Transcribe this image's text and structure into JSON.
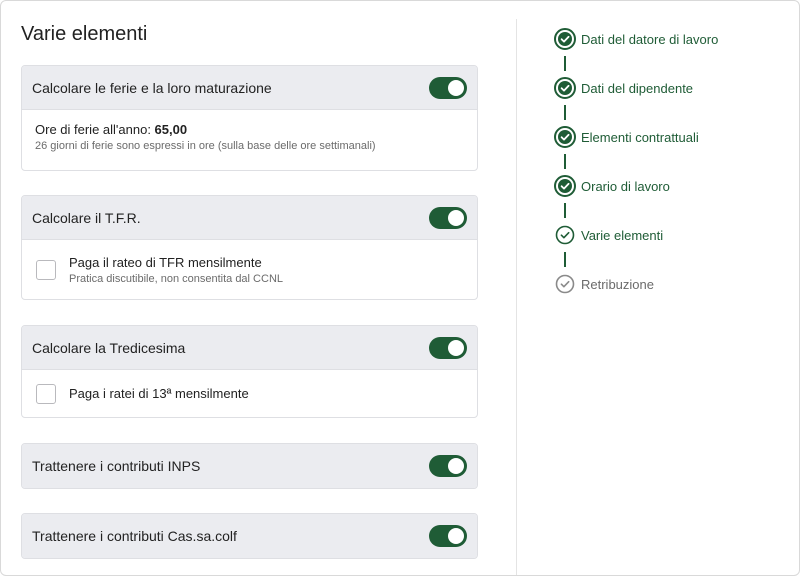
{
  "page": {
    "title": "Varie elementi"
  },
  "sections": [
    {
      "label": "Calcolare le ferie e la loro maturazione",
      "toggle_on": true,
      "info": {
        "label": "Ore di ferie all'anno: ",
        "value": "65,00",
        "note": "26 giorni di ferie sono espressi in ore (sulla base delle ore settimanali)"
      }
    },
    {
      "label": "Calcolare il T.F.R.",
      "toggle_on": true,
      "option": {
        "label": "Paga il rateo di TFR mensilmente",
        "note": "Pratica discutibile, non consentita dal CCNL",
        "checked": false
      }
    },
    {
      "label": "Calcolare la Tredicesima",
      "toggle_on": true,
      "option": {
        "label": "Paga i ratei di 13ª mensilmente",
        "checked": false
      }
    },
    {
      "label": "Trattenere i contributi INPS",
      "toggle_on": true
    },
    {
      "label": "Trattenere i contributi Cas.sa.colf",
      "toggle_on": true
    }
  ],
  "steps": [
    {
      "label": "Dati del datore di lavoro",
      "status": "done"
    },
    {
      "label": "Dati del dipendente",
      "status": "done"
    },
    {
      "label": "Elementi contrattuali",
      "status": "done"
    },
    {
      "label": "Orario di lavoro",
      "status": "done"
    },
    {
      "label": "Varie elementi",
      "status": "current"
    },
    {
      "label": "Retribuzione",
      "status": "pending"
    }
  ],
  "colors": {
    "accent": "#1f5c36",
    "header_bg": "#ebecf0",
    "pending": "#8a8a8a"
  },
  "icons": {
    "step_done": "check-circle-filled-icon",
    "step_current": "check-circle-outline-icon",
    "step_pending": "check-circle-gray-icon"
  }
}
